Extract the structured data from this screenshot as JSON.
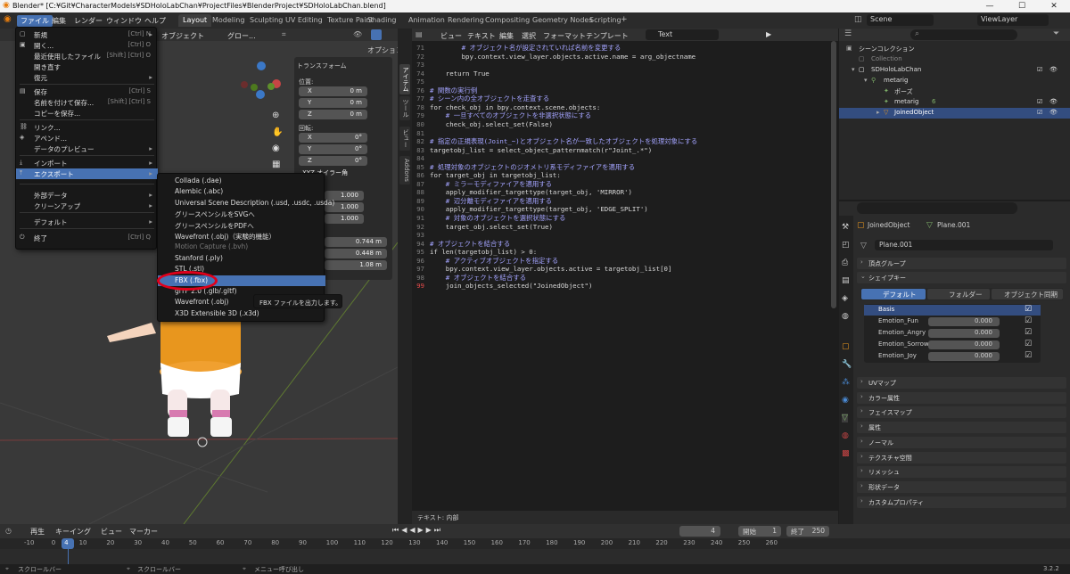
{
  "window": {
    "title": "Blender* [C:¥Git¥CharacterModels¥SDHoloLabChan¥ProjectFiles¥BlenderProject¥SDHoloLabChan.blend]",
    "min": "—",
    "max": "☐",
    "close": "✕"
  },
  "menubar": {
    "file": "ファイル",
    "edit": "編集",
    "render": "レンダー",
    "window": "ウィンドウ",
    "help": "ヘルプ"
  },
  "workspaces": [
    "Layout",
    "Modeling",
    "Sculpting",
    "UV Editing",
    "Texture Paint",
    "Shading",
    "Animation",
    "Rendering",
    "Compositing",
    "Geometry Nodes",
    "Scripting"
  ],
  "scene": {
    "scene": "Scene",
    "viewlayer": "ViewLayer"
  },
  "viewport": {
    "object_menu": "オブジェクト",
    "global": "グロー...",
    "options": "オプション"
  },
  "npanel": {
    "transform": "トランスフォーム",
    "location": "位置:",
    "rotation": "回転:",
    "loc": [
      [
        "X",
        "0 m"
      ],
      [
        "Y",
        "0 m"
      ],
      [
        "Z",
        "0 m"
      ]
    ],
    "rot": [
      [
        "X",
        "0°"
      ],
      [
        "Y",
        "0°"
      ],
      [
        "Z",
        "0°"
      ]
    ],
    "mode": "XYZ オイラー角",
    "scale": [
      "1.000",
      "1.000",
      "1.000"
    ],
    "dims": [
      "0.744 m",
      "0.448 m",
      "1.08 m"
    ]
  },
  "vtabs": [
    "アイテム",
    "ツール",
    "ビュー",
    "Addons"
  ],
  "file_menu": [
    {
      "icon": "▢",
      "label": "新規",
      "shortcut": "[Ctrl] N",
      "arrow": "▸"
    },
    {
      "icon": "▣",
      "label": "開く...",
      "shortcut": "[Ctrl] O",
      "arrow": ""
    },
    {
      "icon": "",
      "label": "最近使用したファイル",
      "shortcut": "[Shift] [Ctrl] O",
      "arrow": ""
    },
    {
      "icon": "",
      "label": "開き直す",
      "shortcut": "",
      "arrow": ""
    },
    {
      "icon": "",
      "label": "復元",
      "shortcut": "",
      "arrow": "▸"
    },
    {
      "icon": "▤",
      "label": "保存",
      "shortcut": "[Ctrl] S",
      "arrow": ""
    },
    {
      "icon": "",
      "label": "名前を付けて保存...",
      "shortcut": "[Shift] [Ctrl] S",
      "arrow": ""
    },
    {
      "icon": "",
      "label": "コピーを保存...",
      "shortcut": "",
      "arrow": ""
    },
    {
      "icon": "⛓",
      "label": "リンク...",
      "shortcut": "",
      "arrow": ""
    },
    {
      "icon": "◈",
      "label": "アペンド...",
      "shortcut": "",
      "arrow": ""
    },
    {
      "icon": "",
      "label": "データのプレビュー",
      "shortcut": "",
      "arrow": "▸"
    },
    {
      "icon": "⤓",
      "label": "インポート",
      "shortcut": "",
      "arrow": "▸"
    },
    {
      "icon": "⤒",
      "label": "エクスポート",
      "shortcut": "",
      "arrow": "▸"
    },
    {
      "icon": "",
      "label": "外部データ",
      "shortcut": "",
      "arrow": "▸"
    },
    {
      "icon": "",
      "label": "クリーンアップ",
      "shortcut": "",
      "arrow": "▸"
    },
    {
      "icon": "",
      "label": "デフォルト",
      "shortcut": "",
      "arrow": "▸"
    },
    {
      "icon": "⏻",
      "label": "終了",
      "shortcut": "[Ctrl] Q",
      "arrow": ""
    }
  ],
  "export_menu": [
    "Collada (.dae)",
    "Alembic (.abc)",
    "Universal Scene Description (.usd, .usdc, .usda)",
    "グリースペンシルをSVGへ",
    "グリースペンシルをPDFへ",
    "Wavefront (.obj)（実験的機能）",
    "Motion Capture (.bvh)",
    "Stanford (.ply)",
    "STL (.stl)",
    "FBX (.fbx)",
    "glTF 2.0 (.glb/.gltf)",
    "Wavefront (.obj)",
    "X3D Extensible 3D (.x3d)"
  ],
  "tooltip": "FBX ファイルを出力します。",
  "text_editor": {
    "view": "ビュー",
    "text": "テキスト",
    "edit": "編集",
    "select": "選択",
    "format": "フォーマット",
    "template": "テンプレート",
    "name": "Text",
    "footer": "テキスト: 内部"
  },
  "code": [
    [
      "71",
      "        # オブジェクト名が設定されていれば名前を変更する"
    ],
    [
      "72",
      "        bpy.context.view_layer.objects.active.name = arg_objectname"
    ],
    [
      "73",
      ""
    ],
    [
      "74",
      "    return True"
    ],
    [
      "75",
      ""
    ],
    [
      "76",
      "# 関数の実行例"
    ],
    [
      "77",
      "# シーン内の全オブジェクトを走査する"
    ],
    [
      "78",
      "for check_obj in bpy.context.scene.objects:"
    ],
    [
      "79",
      "    # 一旦すべてのオブジェクトを非選択状態にする"
    ],
    [
      "80",
      "    check_obj.select_set(False)"
    ],
    [
      "81",
      ""
    ],
    [
      "82",
      "# 指定の正規表現(Joint_~)とオブジェクト名が一致したオブジェクトを処理対象にする"
    ],
    [
      "83",
      "targetobj_list = select_object_patternmatch(r\"Joint_.*\")"
    ],
    [
      "84",
      ""
    ],
    [
      "85",
      "# 処理対象のオブジェクトのジオメトリ系モディファイアを適用する"
    ],
    [
      "86",
      "for target_obj in targetobj_list:"
    ],
    [
      "87",
      "    # ミラーモディファイアを適用する"
    ],
    [
      "88",
      "    apply_modifier_targettype(target_obj, 'MIRROR')"
    ],
    [
      "89",
      "    # 辺分離モディファイアを適用する"
    ],
    [
      "90",
      "    apply_modifier_targettype(target_obj, 'EDGE_SPLIT')"
    ],
    [
      "91",
      "    # 対象のオブジェクトを選択状態にする"
    ],
    [
      "92",
      "    target_obj.select_set(True)"
    ],
    [
      "93",
      ""
    ],
    [
      "94",
      "# オブジェクトを結合する"
    ],
    [
      "95",
      "if len(targetobj_list) > 0:"
    ],
    [
      "96",
      "    # アクティブオブジェクトを指定する"
    ],
    [
      "97",
      "    bpy.context.view_layer.objects.active = targetobj_list[0]"
    ],
    [
      "98",
      "    # オブジェクトを結合する"
    ],
    [
      "99",
      "    join_objects_selected(\"JoinedObject\")"
    ]
  ],
  "outliner": {
    "scene_collection": "シーンコレクション",
    "rows": [
      "Collection",
      "SDHoloLabChan",
      "metarig",
      "ポーズ",
      "metarig",
      "JoinedObject"
    ],
    "pose_count": "6"
  },
  "properties": {
    "object": "JoinedObject",
    "mesh": "Plane.001",
    "mesh_field": "Plane.001",
    "vertex_groups": "頂点グループ",
    "shape_keys": "シェイプキー",
    "tabs": [
      "デフォルト",
      "フォルダー",
      "オブジェクト同期"
    ],
    "keys": [
      [
        "Basis",
        ""
      ],
      [
        "Emotion_Fun",
        "0.000"
      ],
      [
        "Emotion_Angry",
        "0.000"
      ],
      [
        "Emotion_Sorrow",
        "0.000"
      ],
      [
        "Emotion_Joy",
        "0.000"
      ]
    ],
    "sections": [
      "UVマップ",
      "カラー属性",
      "フェイスマップ",
      "属性",
      "ノーマル",
      "テクスチャ空間",
      "リメッシュ",
      "形状データ",
      "カスタムプロパティ"
    ]
  },
  "timeline": {
    "playback": "再生",
    "keying": "キーイング",
    "view": "ビュー",
    "marker": "マーカー",
    "frame": "4",
    "start_label": "開始",
    "start": "1",
    "end_label": "終了",
    "end": "250",
    "ticks": [
      "-10",
      "0",
      "10",
      "20",
      "30",
      "40",
      "50",
      "60",
      "70",
      "80",
      "90",
      "100",
      "110",
      "120",
      "130",
      "140",
      "150",
      "160",
      "170",
      "180",
      "190",
      "200",
      "210",
      "220",
      "230",
      "240",
      "250",
      "260"
    ],
    "current": "4"
  },
  "statusbar": {
    "a": "スクロールバー",
    "b": "スクロールバー",
    "c": "メニュー呼び出し",
    "version": "3.2.2"
  }
}
